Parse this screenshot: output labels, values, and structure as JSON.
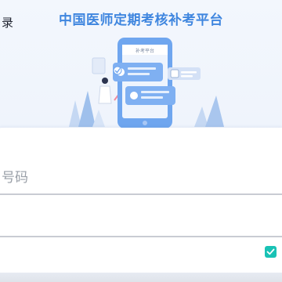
{
  "header": {
    "title": "中国医师定期考核补考平台"
  },
  "illustration": {
    "phone_label": "补考平台"
  },
  "login_card": {
    "heading": "录",
    "account_field": {
      "placeholder": "号码",
      "value": ""
    },
    "password_field": {
      "placeholder": "",
      "value": ""
    },
    "agreement_checkbox": {
      "checked": true
    }
  },
  "colors": {
    "title": "#3f86df",
    "checkbox": "#19c2b5",
    "phone_frame": "#6fa6ef",
    "background": "#eef3fb"
  }
}
